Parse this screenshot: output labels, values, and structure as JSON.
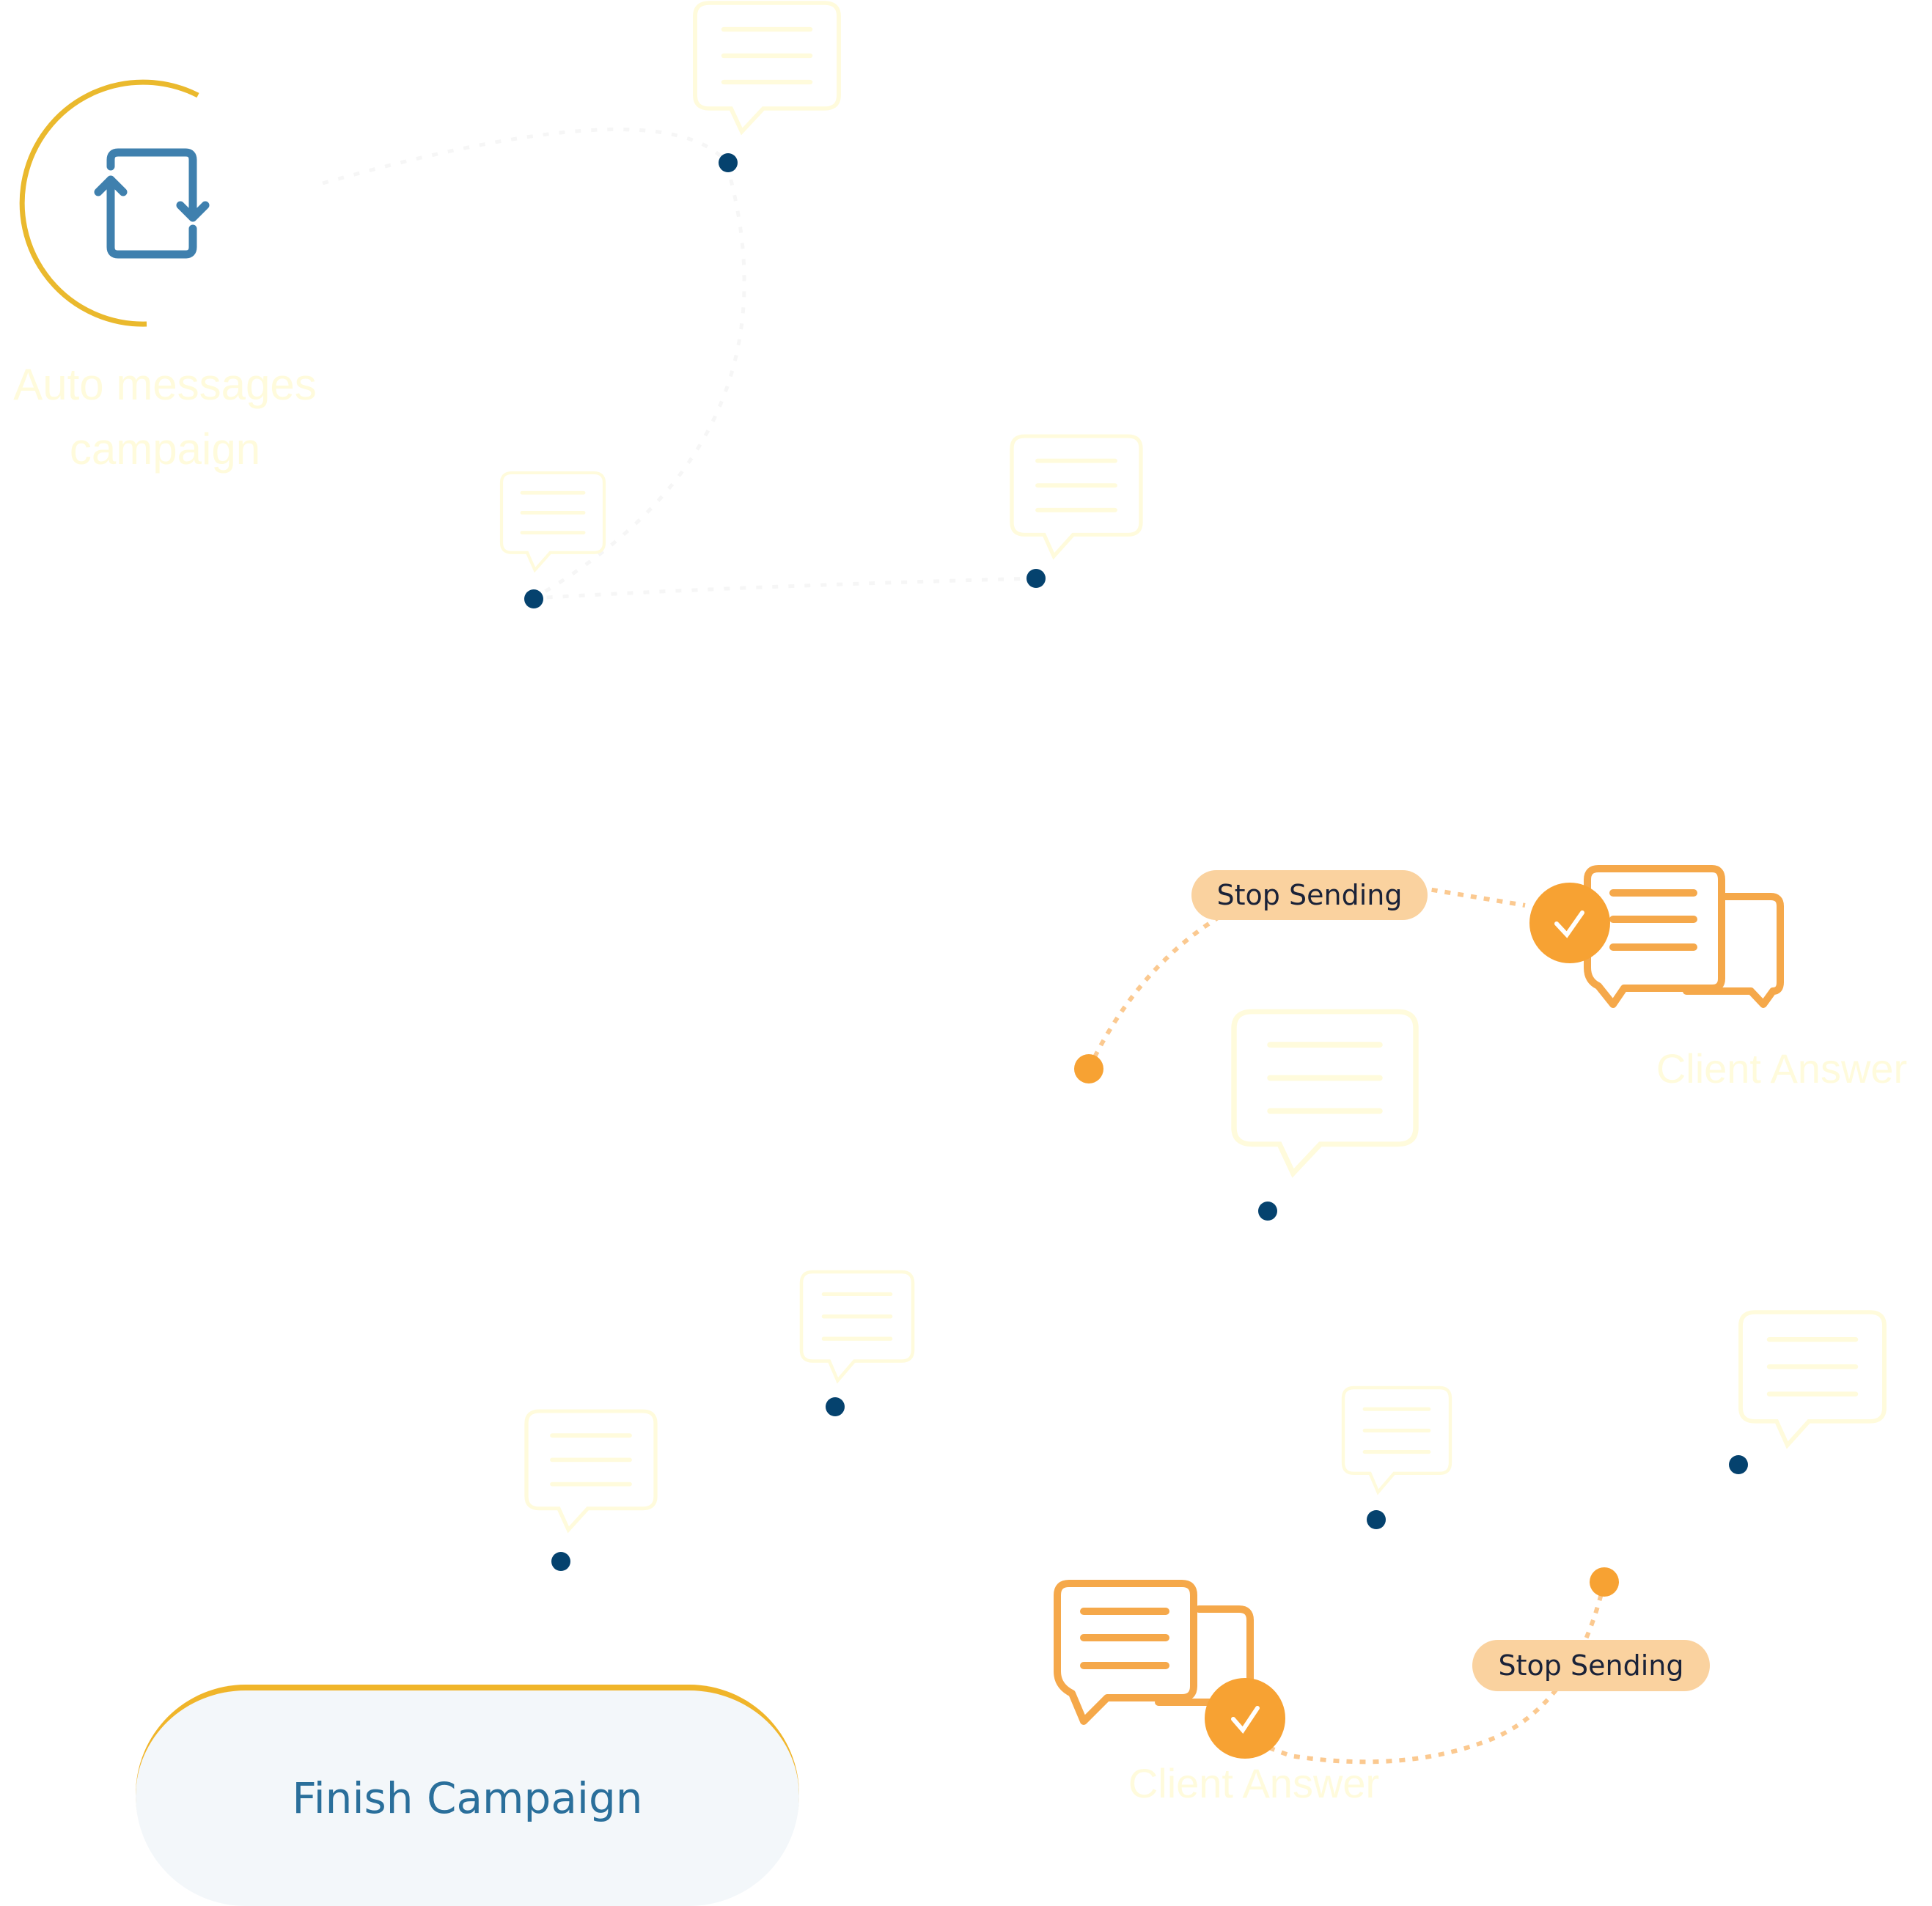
{
  "title": {
    "line1": "Auto messages",
    "line2": "campaign"
  },
  "nodes": {
    "start_icon": "refresh-cycle-icon",
    "message_icon": "message-bubble-icon",
    "client_answer_icon": "chat-bubbles-check-icon"
  },
  "branches": [
    {
      "stop_label": "Stop Sending",
      "answer_label": "Client Answer"
    },
    {
      "stop_label": "Stop Sending",
      "answer_label": "Client Answer"
    }
  ],
  "finish_button": {
    "label": "Finish Campaign"
  },
  "colors": {
    "arc": "#eab92d",
    "icon_blue": "#3f80ae",
    "dot_navy": "#05426e",
    "orange": "#f7a233",
    "orange_stroke": "#f5a84a",
    "pill_bg": "#fad29f",
    "faint_yellow": "#fffbdc",
    "button_text": "#2a6f9b"
  }
}
